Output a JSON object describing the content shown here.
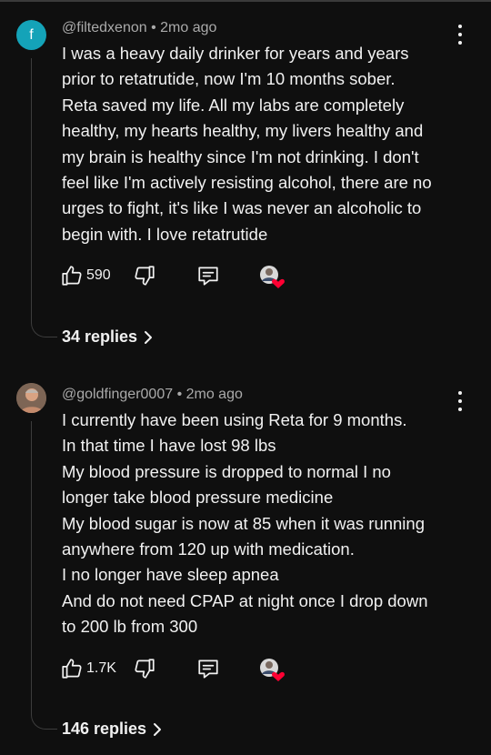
{
  "comments": [
    {
      "avatar_letter": "f",
      "handle": "@filtedxenon",
      "time": "2mo ago",
      "lines": [
        "I was a heavy daily drinker for years and years",
        "prior to retatrutide, now I'm 10 months sober.",
        "Reta saved my life. All my labs are completely",
        "healthy, my hearts healthy, my livers healthy and",
        "my brain is healthy since I'm not drinking. I don't",
        "feel like I'm actively resisting alcohol, there are no",
        "urges to fight, it's like I was never an alcoholic to",
        "begin with. I love retatrutide"
      ],
      "likes": "590",
      "replies": "34 replies"
    },
    {
      "handle": "@goldfinger0007",
      "time": "2mo ago",
      "lines": [
        "I currently have been using Reta for 9 months.",
        "In that time I have lost 98 lbs",
        "My blood pressure is dropped to normal I no",
        "longer take blood pressure medicine",
        "My blood sugar is now at 85 when it was running",
        "anywhere from 120 up with medication.",
        "I no longer have sleep apnea",
        "And do not need CPAP at night once I drop down",
        "to 200 lb from 300"
      ],
      "likes": "1.7K",
      "replies": "146 replies"
    }
  ],
  "colors": {
    "background": "#0f0f0f",
    "avatar_teal": "#14a3b8",
    "heart": "#ff0033",
    "meta": "#aaaaaa"
  },
  "icons": [
    "thumbs-up-icon",
    "thumbs-down-icon",
    "reply-comment-icon",
    "creator-heart-icon",
    "kebab-menu-icon",
    "chevron-right-icon"
  ]
}
